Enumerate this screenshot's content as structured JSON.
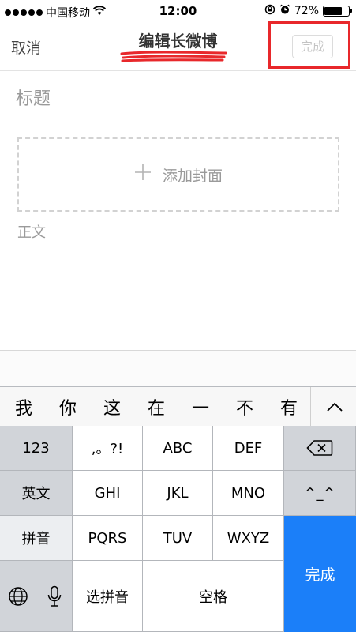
{
  "status_bar": {
    "carrier": "中国移动",
    "time": "12:00",
    "battery": "72%",
    "battery_level": 0.72
  },
  "nav": {
    "cancel": "取消",
    "title": "编辑长微博",
    "done": "完成"
  },
  "editor": {
    "title_placeholder": "标题",
    "cover_label": "添加封面",
    "body_placeholder": "正文"
  },
  "keyboard": {
    "candidates": [
      "我",
      "你",
      "这",
      "在",
      "一",
      "不",
      "有"
    ],
    "keys": {
      "k123": "123",
      "punct": ",。?!",
      "abc": "ABC",
      "def": "DEF",
      "english": "英文",
      "ghi": "GHI",
      "jkl": "JKL",
      "mno": "MNO",
      "emoticon": "^_^",
      "pinyin": "拼音",
      "pqrs": "PQRS",
      "tuv": "TUV",
      "wxyz": "WXYZ",
      "done": "完成",
      "select_pinyin": "选拼音",
      "space": "空格"
    }
  },
  "colors": {
    "highlight_box": "#e8282b",
    "keyboard_done": "#1b7ff9"
  }
}
